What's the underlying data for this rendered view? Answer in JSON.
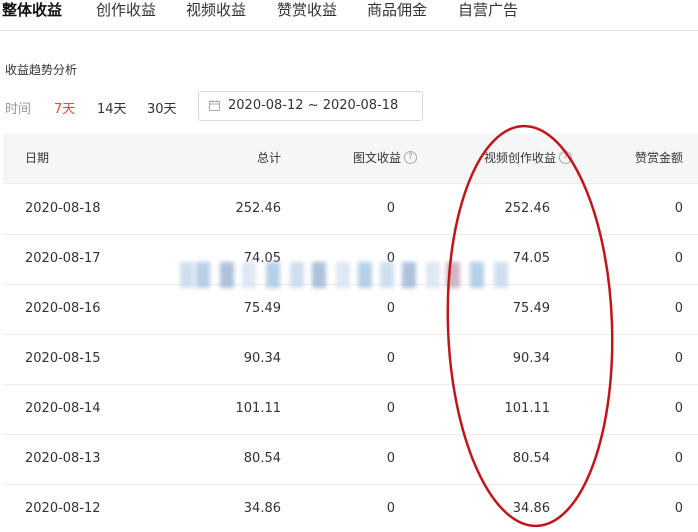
{
  "tabs": [
    {
      "label": "整体收益",
      "active": true
    },
    {
      "label": "创作收益",
      "active": false
    },
    {
      "label": "视频收益",
      "active": false
    },
    {
      "label": "赞赏收益",
      "active": false
    },
    {
      "label": "商品佣金",
      "active": false
    },
    {
      "label": "自营广告",
      "active": false
    }
  ],
  "section_title": "收益趋势分析",
  "filter": {
    "label": "时间",
    "options": [
      "7天",
      "14天",
      "30天"
    ],
    "selected": "7天",
    "date_range": "2020-08-12 ~ 2020-08-18"
  },
  "table": {
    "headers": [
      "日期",
      "总计",
      "图文收益",
      "视频创作收益",
      "赞赏金额"
    ],
    "rows": [
      [
        "2020-08-18",
        "252.46",
        "0",
        "252.46",
        "0"
      ],
      [
        "2020-08-17",
        "74.05",
        "0",
        "74.05",
        "0"
      ],
      [
        "2020-08-16",
        "75.49",
        "0",
        "75.49",
        "0"
      ],
      [
        "2020-08-15",
        "90.34",
        "0",
        "90.34",
        "0"
      ],
      [
        "2020-08-14",
        "101.11",
        "0",
        "101.11",
        "0"
      ],
      [
        "2020-08-13",
        "80.54",
        "0",
        "80.54",
        "0"
      ],
      [
        "2020-08-12",
        "34.86",
        "0",
        "34.86",
        "0"
      ]
    ]
  },
  "colors": {
    "accent": "#e8483b",
    "annotation": "#c0161b",
    "header_bg": "#f5f6f8",
    "watermark": [
      "#a9c7e3",
      "#c6d9ec",
      "#9fb6d6",
      "#d7e4f1",
      "#c9a8bb"
    ]
  },
  "icons": [
    "calendar-icon",
    "help-circle-icon"
  ]
}
